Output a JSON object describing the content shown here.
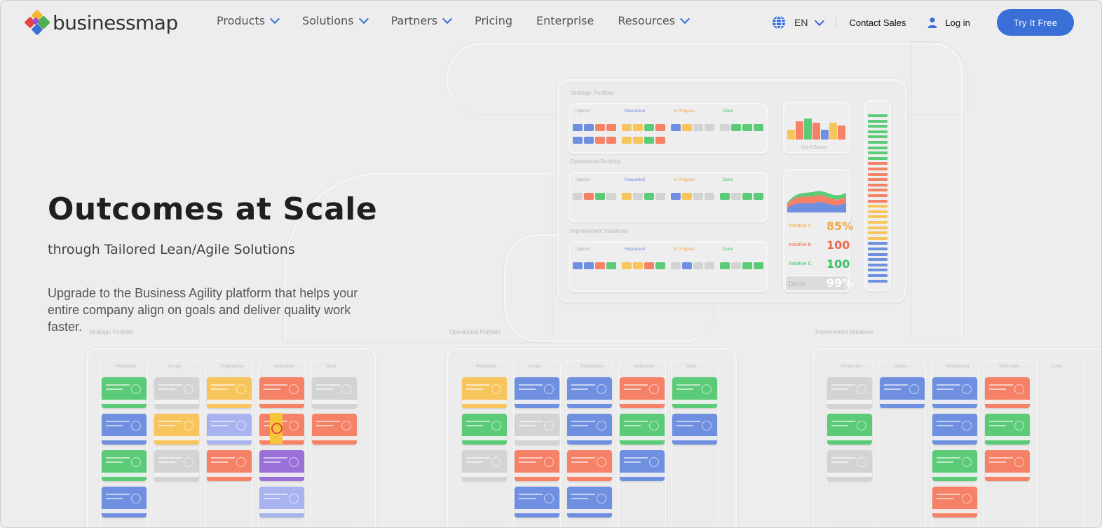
{
  "brand": {
    "name": "businessmap",
    "logo_colors": [
      "#e8433f",
      "#f5b731",
      "#4caf50",
      "#3a6fd8",
      "#9c4fd6"
    ]
  },
  "nav": {
    "items": [
      {
        "label": "Products",
        "dropdown": true
      },
      {
        "label": "Solutions",
        "dropdown": true
      },
      {
        "label": "Partners",
        "dropdown": true
      },
      {
        "label": "Pricing",
        "dropdown": false
      },
      {
        "label": "Enterprise",
        "dropdown": false
      },
      {
        "label": "Resources",
        "dropdown": true
      }
    ]
  },
  "header": {
    "language": "EN",
    "contact_label": "Contact Sales",
    "login_label": "Log in",
    "cta_label": "Try It Free",
    "accent": "#3a6fd8"
  },
  "hero": {
    "title": "Outcomes at Scale",
    "subtitle": "through Tailored Lean/Agile Solutions",
    "description": "Upgrade to the Business Agility platform that helps your entire company align on goals and deliver quality work faster."
  },
  "illustration": {
    "portfolio_titles": [
      "Strategic Portfolio",
      "Operational Portfolio",
      "Improvement Initiatives"
    ],
    "column_labels": [
      "Options",
      "Requested",
      "In Progress",
      "Done"
    ],
    "card_status_label": "Card Status",
    "stats": [
      {
        "label": "Initiative A",
        "value": "85",
        "unit": "%",
        "color": "#f5a742"
      },
      {
        "label": "Initiative B",
        "value": "100",
        "color": "#ef6a4c"
      },
      {
        "label": "Initiative C",
        "value": "100",
        "color": "#3ec066"
      },
      {
        "label": "Done",
        "value": "99",
        "unit": "%",
        "color": "#ffffff"
      }
    ],
    "board_titles": [
      "Strategic Portfolio",
      "Operational Portfolio",
      "Improvement Initiatives"
    ],
    "lane_labels": [
      "Requested",
      "Design",
      "Engineering",
      "Verification",
      "Done"
    ]
  },
  "colors": {
    "blue": "#6f8fe0",
    "green": "#5ccb78",
    "yellow": "#f7c55c",
    "red": "#f58166",
    "grey": "#d3d3d3",
    "purple": "#9a6fd8",
    "lavender": "#a8b4f0"
  }
}
